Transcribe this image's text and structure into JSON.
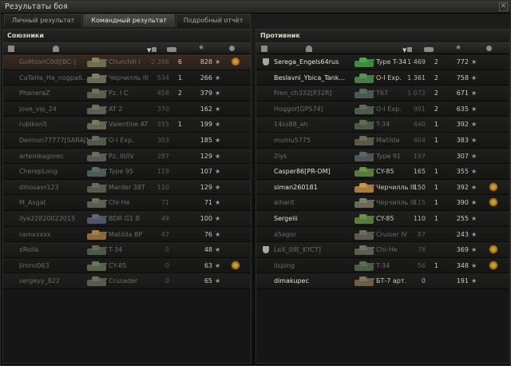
{
  "window": {
    "title": "Результаты боя",
    "close": "✕"
  },
  "tabs": [
    {
      "label": "Личный результат",
      "active": false
    },
    {
      "label": "Командный результат",
      "active": true
    },
    {
      "label": "Подробный отчёт",
      "active": false
    }
  ],
  "allies": {
    "title": "Союзники",
    "rows": [
      {
        "name": "GoMoonC00l[BC-]",
        "tank": "Churchill I",
        "damage": "2 386",
        "frags": "6",
        "xp": "828",
        "me": true,
        "badge": true,
        "color": "#6a7050"
      },
      {
        "name": "CaTaHa_Ha_nogpa6...",
        "tank": "Черчилль III",
        "damage": "534",
        "frags": "1",
        "xp": "266",
        "color": "#6a6a58"
      },
      {
        "name": "PhaneraZ",
        "tank": "Pz. I C",
        "damage": "458",
        "frags": "2",
        "xp": "379",
        "color": "#5a5e4e"
      },
      {
        "name": "jove_vip_24",
        "tank": "AT 2",
        "damage": "370",
        "frags": "",
        "xp": "162",
        "color": "#58604e"
      },
      {
        "name": "rubikon5",
        "tank": "Valentine AT",
        "damage": "355",
        "frags": "1",
        "xp": "199",
        "color": "#626650"
      },
      {
        "name": "Deimon77777[SARAJ]",
        "tank": "O-I Exp.",
        "damage": "303",
        "frags": "",
        "xp": "185",
        "color": "#4e5a4a"
      },
      {
        "name": "artemkagorec",
        "tank": "Pz. III/IV",
        "damage": "287",
        "frags": "",
        "xp": "129",
        "color": "#5a5a50"
      },
      {
        "name": "CherepLong",
        "tank": "Type 95",
        "damage": "119",
        "frags": "",
        "xp": "107",
        "color": "#4e5a58"
      },
      {
        "name": "dinosavr123",
        "tank": "Marder 38T",
        "damage": "110",
        "frags": "",
        "xp": "129",
        "color": "#585a4c"
      },
      {
        "name": "M_Asgat",
        "tank": "Chi-He",
        "damage": "71",
        "frags": "",
        "xp": "71",
        "color": "#5a6050"
      },
      {
        "name": "ilya22820022015",
        "tank": "BDR G1 B",
        "damage": "49",
        "frags": "",
        "xp": "100",
        "color": "#4e5666"
      },
      {
        "name": "ramxxxxx",
        "tank": "Matilda BP",
        "damage": "47",
        "frags": "",
        "xp": "76",
        "color": "#8a6a3a"
      },
      {
        "name": "xRolla",
        "tank": "T-34",
        "damage": "0",
        "frags": "",
        "xp": "48",
        "color": "#4e5a48"
      },
      {
        "name": "Jimmi063",
        "tank": "CY-85",
        "damage": "0",
        "frags": "",
        "xp": "63",
        "badge": true,
        "color": "#56624a"
      },
      {
        "name": "sergeyy_822",
        "tank": "Crusader",
        "damage": "0",
        "frags": "",
        "xp": "65",
        "color": "#5a5a50"
      }
    ]
  },
  "enemies": {
    "title": "Противник",
    "rows": [
      {
        "name": "Serega_Engels64rus",
        "tank": "Type T-34",
        "damage": "1 469",
        "frags": "2",
        "xp": "772",
        "alive": true,
        "squad": true,
        "color": "#3e8a3e"
      },
      {
        "name": "Beslavni_Ybica_Tank...",
        "tank": "O-I Exp.",
        "damage": "1 361",
        "frags": "2",
        "xp": "758",
        "alive": true,
        "color": "#4a7a4a"
      },
      {
        "name": "Fren_ch332[P32R]",
        "tank": "T67",
        "damage": "1 072",
        "frags": "2",
        "xp": "671",
        "color": "#4a5a4e"
      },
      {
        "name": "Hoggor[GPS74]",
        "tank": "O-I Exp.",
        "damage": "991",
        "frags": "2",
        "xp": "635",
        "color": "#4e5a4a"
      },
      {
        "name": "14ss88_ah",
        "tank": "T-34",
        "damage": "440",
        "frags": "1",
        "xp": "392",
        "color": "#4e5a48"
      },
      {
        "name": "mumu5775",
        "tank": "Matilda",
        "damage": "404",
        "frags": "1",
        "xp": "383",
        "color": "#5a5a4c"
      },
      {
        "name": "2lyk",
        "tank": "Type 91",
        "damage": "197",
        "frags": "",
        "xp": "307",
        "color": "#4e5656"
      },
      {
        "name": "Casper86[PR-OM]",
        "tank": "CY-85",
        "damage": "165",
        "frags": "1",
        "xp": "355",
        "alive": true,
        "color": "#5a7a3e"
      },
      {
        "name": "siman260181",
        "tank": "Черчилль III",
        "damage": "150",
        "frags": "1",
        "xp": "392",
        "alive": true,
        "badge": true,
        "color": "#a87a40"
      },
      {
        "name": "alharit",
        "tank": "Черчилль III",
        "damage": "115",
        "frags": "1",
        "xp": "390",
        "badge": true,
        "color": "#6a6a58"
      },
      {
        "name": "Sergeiii",
        "tank": "CY-85",
        "damage": "110",
        "frags": "1",
        "xp": "255",
        "alive": true,
        "color": "#5a7a3e"
      },
      {
        "name": "a5egor",
        "tank": "Cruiser IV",
        "damage": "87",
        "frags": "",
        "xp": "243",
        "color": "#5a5a50"
      },
      {
        "name": "LeX_09[_KYCT]",
        "tank": "Chi-He",
        "damage": "78",
        "frags": "",
        "xp": "369",
        "squad": true,
        "badge": true,
        "color": "#5a6050"
      },
      {
        "name": "lisping",
        "tank": "T-34",
        "damage": "56",
        "frags": "1",
        "xp": "348",
        "badge": true,
        "color": "#4e5a48"
      },
      {
        "name": "dimakupec",
        "tank": "БТ-7 арт.",
        "damage": "0",
        "frags": "",
        "xp": "191",
        "alive": true,
        "color": "#6a6048"
      }
    ]
  }
}
